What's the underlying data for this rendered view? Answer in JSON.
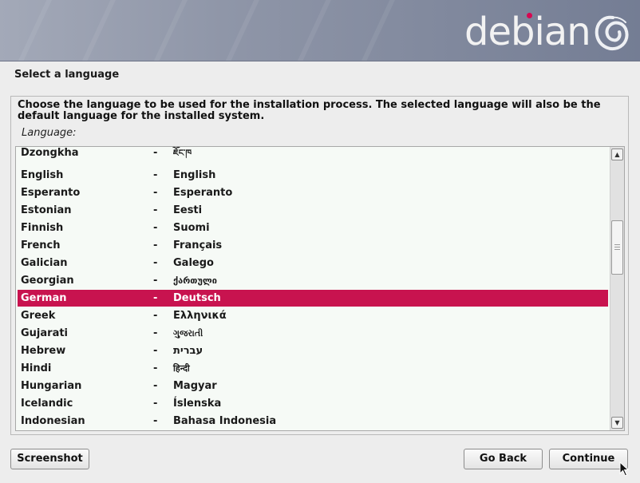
{
  "header": {
    "brand": "debian",
    "accent_color": "#d70751"
  },
  "page": {
    "title": "Select a language"
  },
  "panel": {
    "instruction": "Choose the language to be used for the installation process. The selected language will also be the default language for the installed system.",
    "field_label": "Language:"
  },
  "languages": [
    {
      "name": "Dzongkha",
      "sep": "-",
      "native": "ཇོང་ཁ"
    },
    {
      "name": "English",
      "sep": "-",
      "native": "English"
    },
    {
      "name": "Esperanto",
      "sep": "-",
      "native": "Esperanto"
    },
    {
      "name": "Estonian",
      "sep": "-",
      "native": "Eesti"
    },
    {
      "name": "Finnish",
      "sep": "-",
      "native": "Suomi"
    },
    {
      "name": "French",
      "sep": "-",
      "native": "Français"
    },
    {
      "name": "Galician",
      "sep": "-",
      "native": "Galego"
    },
    {
      "name": "Georgian",
      "sep": "-",
      "native": "ქართული"
    },
    {
      "name": "German",
      "sep": "-",
      "native": "Deutsch"
    },
    {
      "name": "Greek",
      "sep": "-",
      "native": "Ελληνικά"
    },
    {
      "name": "Gujarati",
      "sep": "-",
      "native": "ગુજરાતી"
    },
    {
      "name": "Hebrew",
      "sep": "-",
      "native": "עברית"
    },
    {
      "name": "Hindi",
      "sep": "-",
      "native": "हिन्दी"
    },
    {
      "name": "Hungarian",
      "sep": "-",
      "native": "Magyar"
    },
    {
      "name": "Icelandic",
      "sep": "-",
      "native": "Íslenska"
    },
    {
      "name": "Indonesian",
      "sep": "-",
      "native": "Bahasa Indonesia"
    }
  ],
  "selected_language": "German",
  "colors": {
    "selection": "#c8134f",
    "list_background": "#f6faf6"
  },
  "buttons": {
    "screenshot": "Screenshot",
    "go_back": "Go Back",
    "continue": "Continue"
  },
  "icons": {
    "logo_swirl": "debian-swirl-icon",
    "scroll_up": "arrow-up-icon",
    "scroll_down": "arrow-down-icon",
    "cursor": "mouse-pointer-icon"
  }
}
